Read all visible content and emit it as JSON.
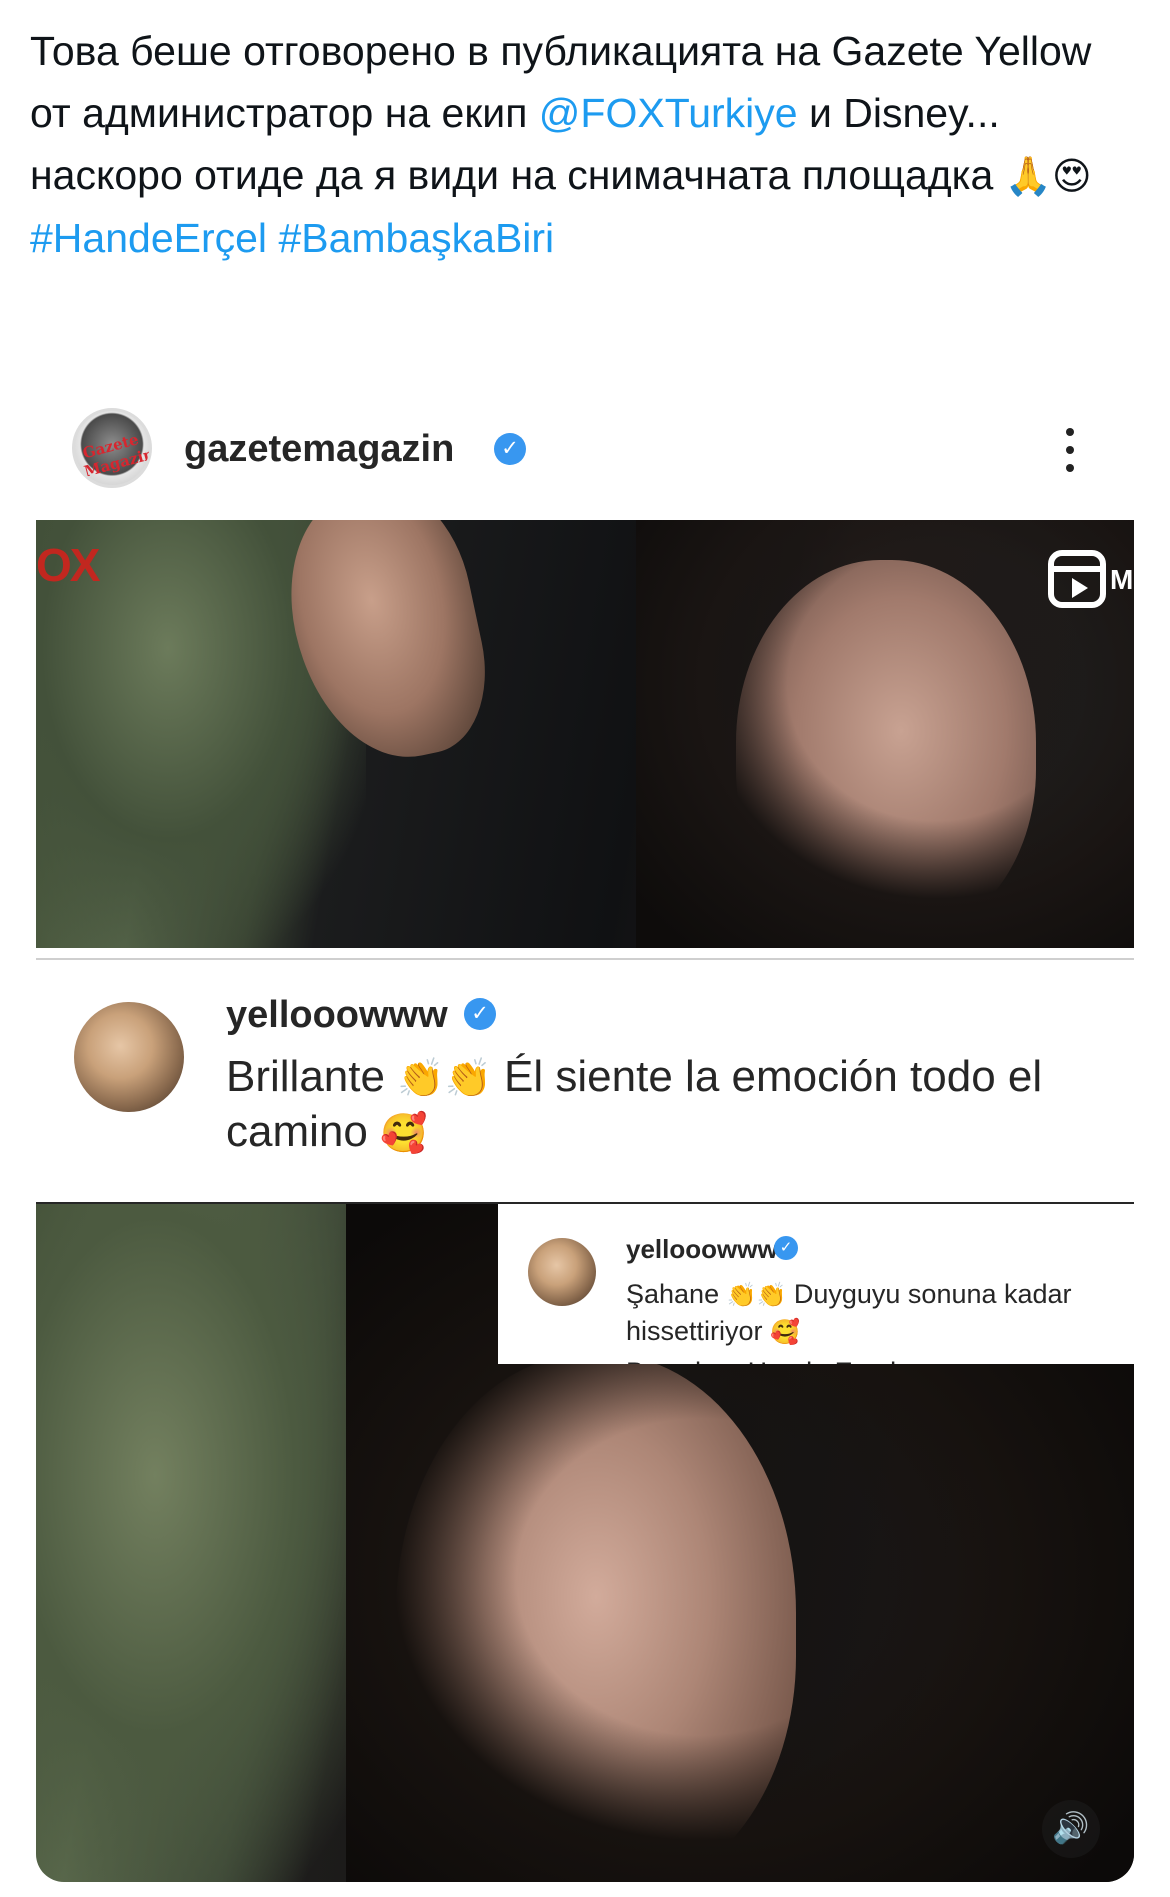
{
  "tweet": {
    "text_part1": "Това беше отговорено в публикацията на Gazete Yellow от администратор на екип ",
    "mention": "@FOXTurkiye",
    "text_part2": " и Disney... наскоро отиде да я види на снимачната площадка ",
    "emoji_pray": "🙏",
    "emoji_heart_eyes": "😍",
    "hashtag1": "#HandeErçel",
    "hashtag2": "#BambaşkaBiri"
  },
  "ig_post": {
    "avatar_text": "Gazete Magazin",
    "username": "gazetemagazin",
    "verified_glyph": "✓",
    "more_icon": "vertical-ellipsis-icon",
    "video_top": {
      "channel_logo": "OX",
      "reels_icon": "reels-icon",
      "corner_text": "MS"
    },
    "comment": {
      "username": "yellooowww",
      "text_before": "Brillante ",
      "emoji_clap": "👏👏",
      "text_after": " Él siente la emoción todo el camino ",
      "emoji_smile_hearts": "🥰"
    },
    "overlay_comment": {
      "username": "yellooowww",
      "text_before": "Şahane ",
      "emoji_clap": "👏👏",
      "text_after": " Duyguyu sonuna kadar hissettiriyor ",
      "emoji_smile_hearts": "🥰",
      "cut_text": "Bu sahne Hande Erçel"
    },
    "mute_glyph": "🔊"
  }
}
